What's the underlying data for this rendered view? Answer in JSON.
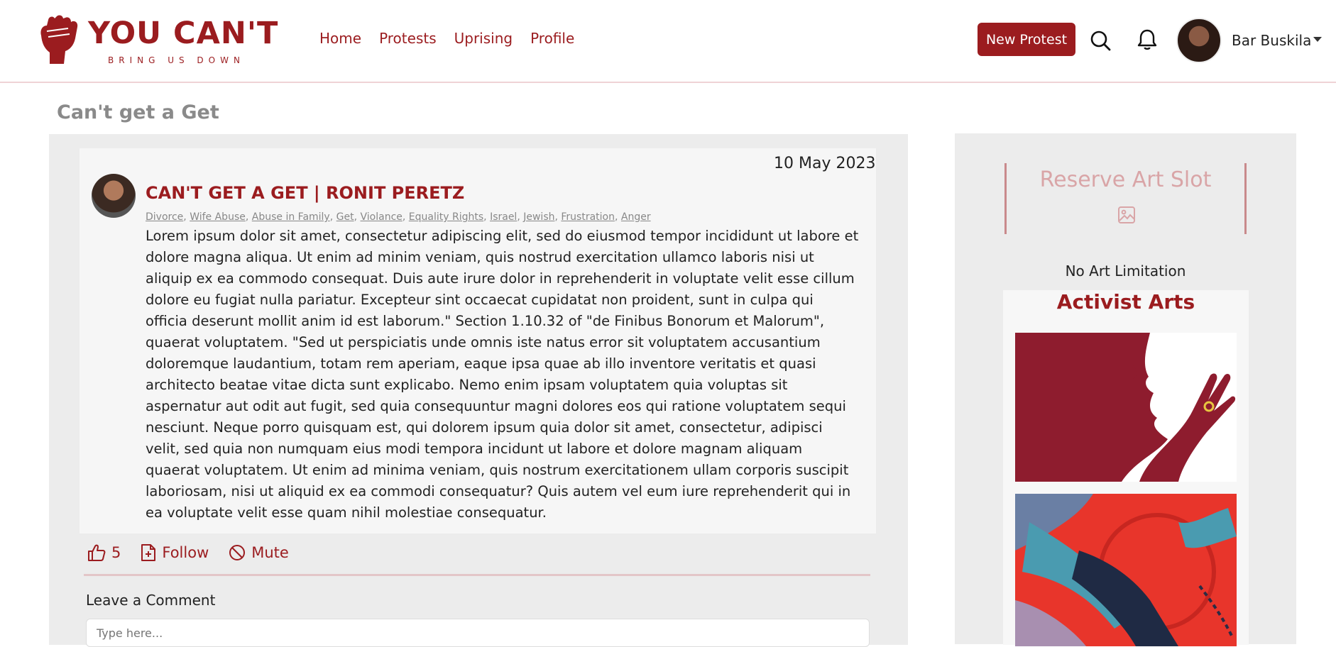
{
  "header": {
    "logo_title": "YOU CAN'T",
    "logo_subtitle": "BRING US DOWN",
    "nav": [
      {
        "label": "Home"
      },
      {
        "label": "Protests"
      },
      {
        "label": "Uprising"
      },
      {
        "label": "Profile"
      }
    ],
    "new_protest_label": "New Protest",
    "search_icon": "search-icon",
    "bell_icon": "bell-icon",
    "user_name": "Bar Buskila"
  },
  "page": {
    "title": "Can't get a Get"
  },
  "post": {
    "date": "10 May 2023",
    "title": "CAN'T GET A GET | RONIT PERETZ",
    "tags": [
      "Divorce",
      "Wife Abuse",
      "Abuse in Family",
      "Get",
      "Violance",
      "Equality Rights",
      "Israel",
      "Jewish",
      "Frustration",
      "Anger"
    ],
    "body": "Lorem ipsum dolor sit amet, consectetur adipiscing elit, sed do eiusmod tempor incididunt ut labore et dolore magna aliqua. Ut enim ad minim veniam, quis nostrud exercitation ullamco laboris nisi ut aliquip ex ea commodo consequat. Duis aute irure dolor in reprehenderit in voluptate velit esse cillum dolore eu fugiat nulla pariatur. Excepteur sint occaecat cupidatat non proident, sunt in culpa qui officia deserunt mollit anim id est laborum.\" Section 1.10.32 of \"de Finibus Bonorum et Malorum\", quaerat voluptatem. \"Sed ut perspiciatis unde omnis iste natus error sit voluptatem accusantium doloremque laudantium, totam rem aperiam, eaque ipsa quae ab illo inventore veritatis et quasi architecto beatae vitae dicta sunt explicabo. Nemo enim ipsam voluptatem quia voluptas sit aspernatur aut odit aut fugit, sed quia consequuntur magni dolores eos qui ratione voluptatem sequi nesciunt. Neque porro quisquam est, qui dolorem ipsum quia dolor sit amet, consectetur, adipisci velit, sed quia non numquam eius modi tempora incidunt ut labore et dolore magnam aliquam quaerat voluptatem. Ut enim ad minima veniam, quis nostrum exercitationem ullam corporis suscipit laboriosam, nisi ut aliquid ex ea commodi consequatur? Quis autem vel eum iure reprehenderit qui in ea voluptate velit esse quam nihil molestiae consequatur.",
    "likes": "5",
    "follow_label": "Follow",
    "mute_label": "Mute"
  },
  "comment": {
    "label": "Leave a Comment",
    "placeholder": "Type here..."
  },
  "sidebar": {
    "reserve_title": "Reserve Art Slot",
    "no_limit": "No Art Limitation",
    "arts_title": "Activist Arts"
  },
  "colors": {
    "brand": "#9b1c1f",
    "reserve_text": "#d9a5a7",
    "panel_bg": "#ececec"
  }
}
